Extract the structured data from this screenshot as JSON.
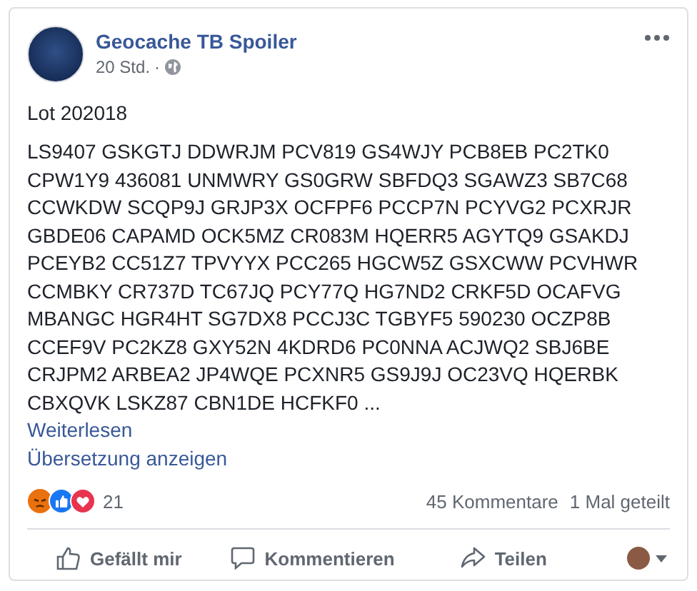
{
  "post": {
    "author": "Geocache TB Spoiler",
    "time": "20 Std.",
    "separator": "·",
    "title": "Lot 202018",
    "lines": [
      "LS9407 GSKGTJ DDWRJM PCV819 GS4WJY PCB8EB PC2TK0",
      "CPW1Y9 436081 UNMWRY GS0GRW SBFDQ3 SGAWZ3 SB7C68",
      "CCWKDW SCQP9J GRJP3X OCFPF6 PCCP7N PCYVG2 PCXRJR",
      "GBDE06 CAPAMD OCK5MZ CR083M HQERR5 AGYTQ9 GSAKDJ",
      "PCEYB2 CC51Z7 TPVYYX PCC265 HGCW5Z GSXCWW PCVHWR",
      "CCMBKY CR737D TC67JQ PCY77Q HG7ND2 CRKF5D OCAFVG",
      "MBANGC HGR4HT SG7DX8 PCCJ3C TGBYF5 590230 OCZP8B",
      "CCEF9V PC2KZ8 GXY52N 4KDRD6 PC0NNA ACJWQ2 SBJ6BE",
      "CRJPM2 ARBEA2 JP4WQE PCXNR5 GS9J9J OC23VQ HQERBK",
      "CBXQVK LSKZ87 CBN1DE HCFKF0 ..."
    ],
    "read_more": "Weiterlesen",
    "translate": "Übersetzung anzeigen"
  },
  "reactions": {
    "count": "21",
    "comments": "45 Kommentare",
    "shares": "1 Mal geteilt"
  },
  "actions": [
    {
      "kind": "like",
      "label": "Gefällt mir"
    },
    {
      "kind": "comment",
      "label": "Kommentieren"
    },
    {
      "kind": "share",
      "label": "Teilen"
    }
  ]
}
